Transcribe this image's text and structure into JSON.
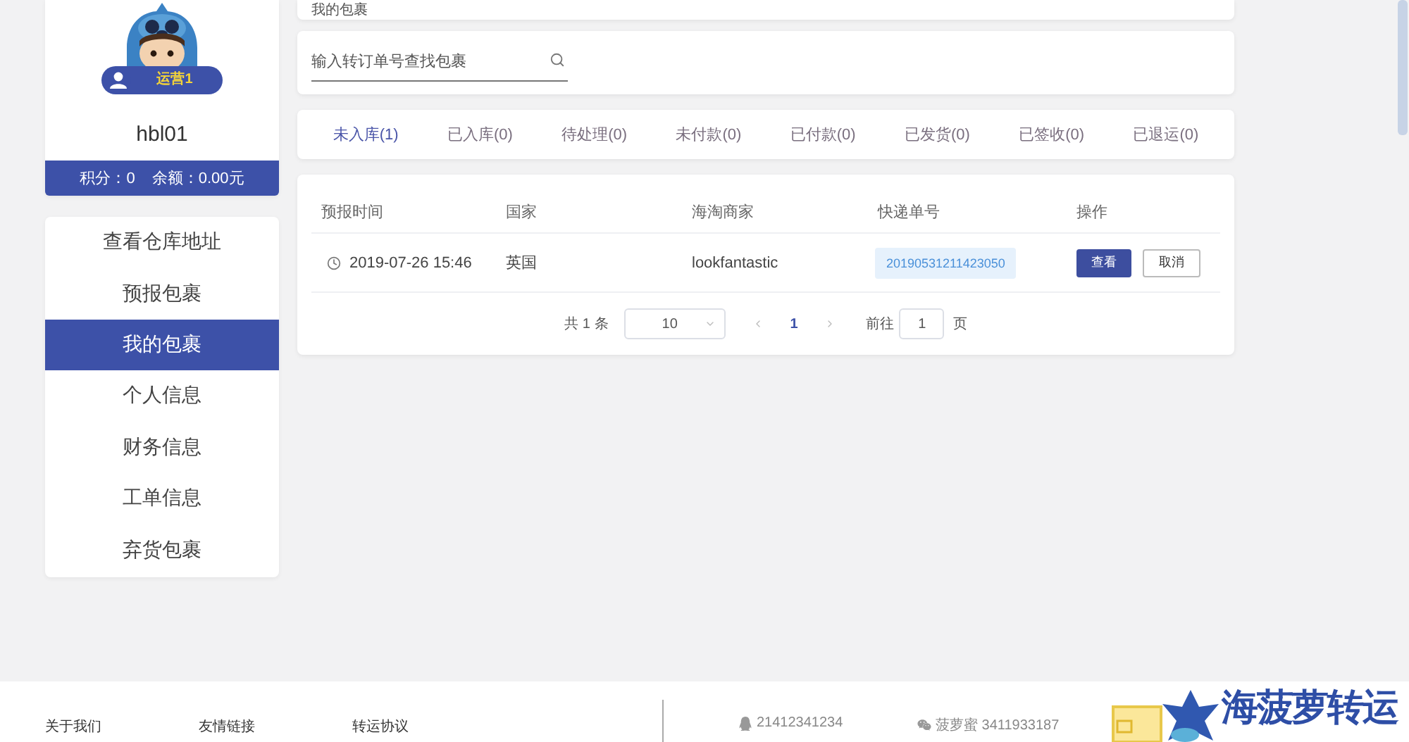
{
  "top_card": {
    "title": "我的包裹"
  },
  "profile": {
    "badge": "运营1",
    "username": "hbl01",
    "points_label": "积分：0",
    "balance_label": "余额：0.00元"
  },
  "menu": [
    {
      "label": "查看仓库地址",
      "selected": false
    },
    {
      "label": "预报包裹",
      "selected": false
    },
    {
      "label": "我的包裹",
      "selected": true
    },
    {
      "label": "个人信息",
      "selected": false
    },
    {
      "label": "财务信息",
      "selected": false
    },
    {
      "label": "工单信息",
      "selected": false
    },
    {
      "label": "弃货包裹",
      "selected": false
    }
  ],
  "search": {
    "placeholder": "输入转订单号查找包裹"
  },
  "tabs": [
    {
      "label": "未入库(1)",
      "selected": true
    },
    {
      "label": "已入库(0)",
      "selected": false
    },
    {
      "label": "待处理(0)",
      "selected": false
    },
    {
      "label": "未付款(0)",
      "selected": false
    },
    {
      "label": "已付款(0)",
      "selected": false
    },
    {
      "label": "已发货(0)",
      "selected": false
    },
    {
      "label": "已签收(0)",
      "selected": false
    },
    {
      "label": "已退运(0)",
      "selected": false
    }
  ],
  "table": {
    "columns": [
      "预报时间",
      "国家",
      "海淘商家",
      "快递单号",
      "操作"
    ],
    "rows": [
      {
        "time": "2019-07-26 15:46",
        "country": "英国",
        "merchant": "lookfantastic",
        "tracking": "20190531211423050",
        "actions": [
          {
            "label": "查看",
            "kind": "primary"
          },
          {
            "label": "取消",
            "kind": "plain"
          }
        ]
      }
    ]
  },
  "pagination": {
    "total": "共 1 条",
    "page_size": "10",
    "pages": [
      {
        "label": "1",
        "selected": true
      }
    ],
    "goto_label": "前往",
    "goto_value": "1",
    "goto_suffix": "页"
  },
  "footer": {
    "links": [
      "关于我们",
      "友情链接",
      "转运协议"
    ],
    "contacts": [
      {
        "kind": "qq",
        "text": "21412341234"
      },
      {
        "kind": "wechat",
        "text": "菠萝蜜 3411933187"
      }
    ],
    "logo": "海菠萝转运"
  }
}
